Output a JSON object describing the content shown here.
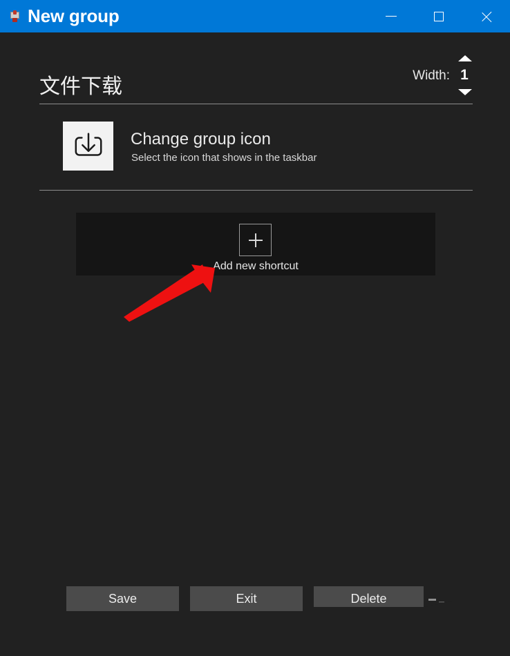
{
  "window": {
    "title": "New group",
    "icon": "app-icon",
    "titlebar_color": "#0078d7",
    "background_color": "#212121",
    "controls": [
      {
        "name": "minimize",
        "glyph": "minimize-icon"
      },
      {
        "name": "maximize",
        "glyph": "maximize-icon"
      },
      {
        "name": "close",
        "glyph": "close-icon"
      }
    ]
  },
  "header": {
    "group_title": "文件下载",
    "width_label": "Width:",
    "width_value": "1",
    "spinner_up": "spinner-up-icon",
    "spinner_down": "spinner-down-icon"
  },
  "icon_section": {
    "icon_name": "download-icon",
    "title": "Change group icon",
    "subtitle": "Select the icon that shows in the taskbar",
    "icon_background": "#f2f2f2"
  },
  "shortcuts": {
    "add_icon": "plus-icon",
    "add_label": "Add new shortcut",
    "panel_background": "#151515"
  },
  "annotation": {
    "type": "arrow",
    "color": "#ee1111",
    "points_to": "Add new shortcut"
  },
  "footer": {
    "buttons": [
      {
        "label": "Save",
        "name": "save-button"
      },
      {
        "label": "Exit",
        "name": "exit-button"
      },
      {
        "label": "Delete",
        "name": "delete-button"
      }
    ],
    "button_color": "#4b4b4b"
  }
}
